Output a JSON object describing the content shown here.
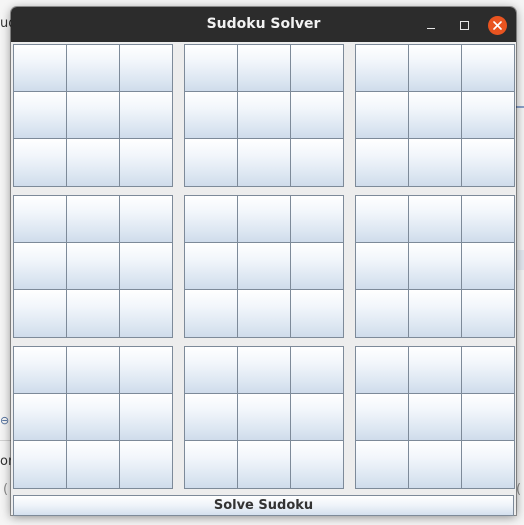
{
  "window": {
    "title": "Sudoku Solver"
  },
  "background": {
    "fragments": [
      "ud",
      "or",
      "(",
      "(",
      "⊖"
    ]
  },
  "grid": {
    "rows": 9,
    "cols": 9,
    "values": [
      [
        "",
        "",
        "",
        "",
        "",
        "",
        "",
        "",
        ""
      ],
      [
        "",
        "",
        "",
        "",
        "",
        "",
        "",
        "",
        ""
      ],
      [
        "",
        "",
        "",
        "",
        "",
        "",
        "",
        "",
        ""
      ],
      [
        "",
        "",
        "",
        "",
        "",
        "",
        "",
        "",
        ""
      ],
      [
        "",
        "",
        "",
        "",
        "",
        "",
        "",
        "",
        ""
      ],
      [
        "",
        "",
        "",
        "",
        "",
        "",
        "",
        "",
        ""
      ],
      [
        "",
        "",
        "",
        "",
        "",
        "",
        "",
        "",
        ""
      ],
      [
        "",
        "",
        "",
        "",
        "",
        "",
        "",
        "",
        ""
      ],
      [
        "",
        "",
        "",
        "",
        "",
        "",
        "",
        "",
        ""
      ]
    ]
  },
  "actions": {
    "solve_label": "Solve Sudoku"
  },
  "colors": {
    "titlebar": "#2c2c2c",
    "close_button": "#e95420",
    "cell_border": "#7d8a99"
  },
  "icons": {
    "minimize": "minimize-icon",
    "maximize": "maximize-icon",
    "close": "close-icon"
  }
}
